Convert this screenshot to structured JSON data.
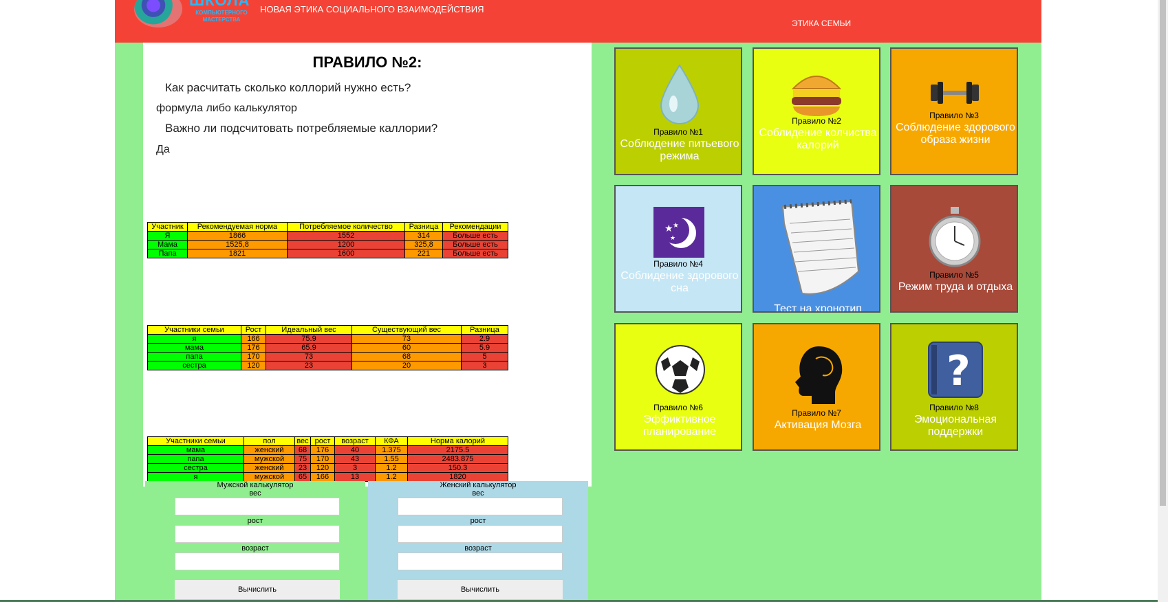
{
  "header": {
    "logo_title": "ШКОЛА",
    "logo_subtitle": "КОМПЬЮТЕРНОГО МАСТЕРСТВА",
    "site_title": "НОВАЯ ЭТИКА СОЦИАЛЬНОГО ВЗАИМОДЕЙСТВИЯ",
    "nav_link": "ЭТИКА СЕМЬИ"
  },
  "content": {
    "title": "ПРАВИЛО №2:",
    "q1": "Как расчитать сколько коллорий нужно есть?",
    "a1": "формула либо калькулятор",
    "q2": "Важно ли подсчитовать потребляемые каллории?",
    "a2": "Да"
  },
  "table1": {
    "headers": [
      "Участник",
      "Рекомендуемая норма",
      "Потребляемое количество",
      "Разница",
      "Рекомендации"
    ],
    "rows": [
      [
        "Я",
        "1866",
        "1552",
        "314",
        "Больше есть"
      ],
      [
        "Мама",
        "1525,8",
        "1200",
        "325,8",
        "Больше есть"
      ],
      [
        "Папа",
        "1821",
        "1600",
        "221",
        "Больше есть"
      ]
    ]
  },
  "table2": {
    "headers": [
      "Участники семьи",
      "Рост",
      "Идеальный вес",
      "Существующий вес",
      "Разница"
    ],
    "rows": [
      [
        "я",
        "166",
        "75.9",
        "73",
        "2.9"
      ],
      [
        "мама",
        "176",
        "65.9",
        "60",
        "5.9"
      ],
      [
        "папа",
        "170",
        "73",
        "68",
        "5"
      ],
      [
        "сестра",
        "120",
        "23",
        "20",
        "3"
      ]
    ]
  },
  "table3": {
    "headers": [
      "Участники семьи",
      "пол",
      "вес",
      "рост",
      "возраст",
      "КФА",
      "Норма калорий"
    ],
    "rows": [
      [
        "мама",
        "женский",
        "68",
        "176",
        "40",
        "1.375",
        "2175.5"
      ],
      [
        "папа",
        "мужской",
        "75",
        "170",
        "43",
        "1.55",
        "2483.875"
      ],
      [
        "сестра",
        "женский",
        "23",
        "120",
        "3",
        "1.2",
        "150.3"
      ],
      [
        "я",
        "мужской",
        "65",
        "166",
        "13",
        "1.2",
        "1820"
      ]
    ]
  },
  "calculators": {
    "male": {
      "title": "Мужской калькулятор",
      "weight": "вес",
      "height": "рост",
      "age": "возраст",
      "button": "Вычислить"
    },
    "female": {
      "title": "Женский калькулятор",
      "weight": "вес",
      "height": "рост",
      "age": "возраст",
      "button": "Вычислить"
    }
  },
  "tiles": [
    {
      "num": "Правило №1",
      "name": "Соблюдение питьевого режима",
      "color": "#bccf00",
      "icon": "water-drop-icon"
    },
    {
      "num": "Правило №2",
      "name": "Соблидение колчиства калорий",
      "color": "#e8ff12",
      "icon": "burger-icon"
    },
    {
      "num": "Правило №3",
      "name": "Соблюдение здорового образа жизни",
      "color": "#f7a800",
      "icon": "dumbbell-icon"
    },
    {
      "num": "Правило №4",
      "name": "Соблидение здорового сна",
      "color": "#c5e6f5",
      "icon": "moon-icon"
    },
    {
      "num": "",
      "name": "Тест на хронотип",
      "color": "#4a90e2",
      "icon": "notepad-icon"
    },
    {
      "num": "Правило №5",
      "name": "Режим труда и отдыха",
      "color": "#a84a3a",
      "icon": "stopwatch-icon"
    },
    {
      "num": "Правило №6",
      "name": "Эффиктивное планирование",
      "color": "#e8ff12",
      "icon": "soccer-ball-icon"
    },
    {
      "num": "Правило №7",
      "name": "Активация Мозга",
      "color": "#f7a800",
      "icon": "head-icon"
    },
    {
      "num": "Правило №8",
      "name": "Эмоциональная поддержки",
      "color": "#bccf00",
      "icon": "help-book-icon"
    }
  ]
}
